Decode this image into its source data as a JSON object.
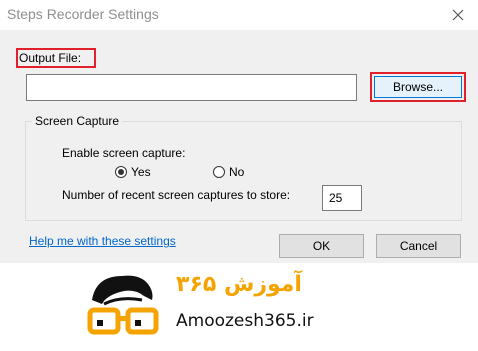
{
  "window": {
    "title": "Steps Recorder Settings",
    "close_icon": "close-icon"
  },
  "output": {
    "label": "Output File:",
    "value": "",
    "browse_label": "Browse..."
  },
  "capture": {
    "group_title": "Screen Capture",
    "enable_label": "Enable screen capture:",
    "yes_label": "Yes",
    "no_label": "No",
    "selected": "Yes",
    "count_label": "Number of recent screen captures to store:",
    "count_value": "25"
  },
  "footer": {
    "help_link": "Help me with these settings",
    "ok_label": "OK",
    "cancel_label": "Cancel"
  },
  "watermark": {
    "persian_text": "آموزش ۳۶۵",
    "latin_text": "Amoozesh365.ir",
    "accent": "#f5a300"
  },
  "colors": {
    "highlight": "#e0202a",
    "link": "#0066cc",
    "focus": "#0078d7"
  }
}
